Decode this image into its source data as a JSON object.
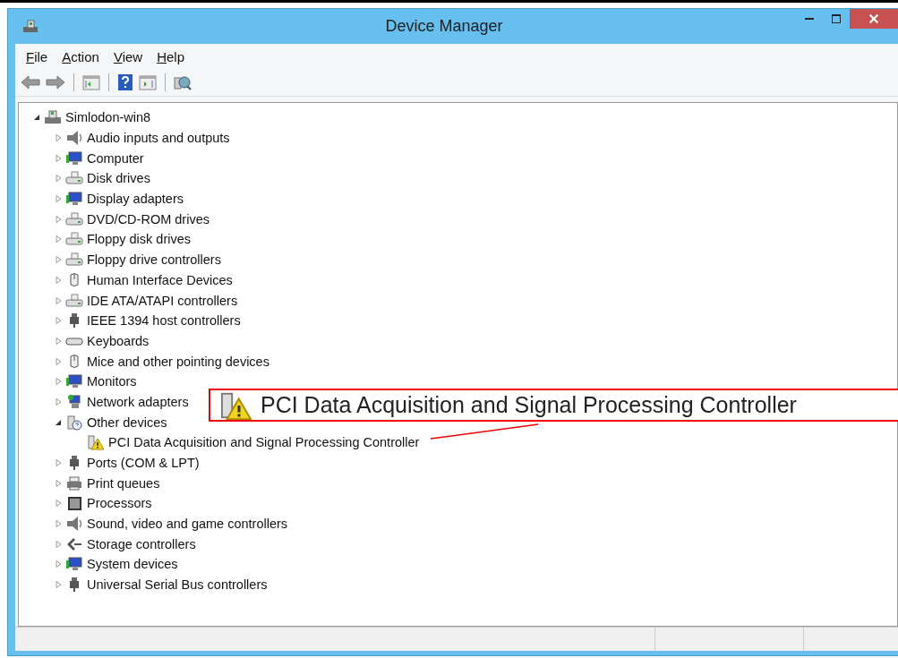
{
  "window": {
    "title": "Device Manager"
  },
  "menu": [
    {
      "label": "File"
    },
    {
      "label": "Action"
    },
    {
      "label": "View"
    },
    {
      "label": "Help"
    }
  ],
  "tree": {
    "label": "Simlodon-win8",
    "kind": "computer",
    "expanded": true,
    "children": [
      {
        "label": "Audio inputs and outputs",
        "kind": "speaker",
        "expanded": false
      },
      {
        "label": "Computer",
        "kind": "monitor",
        "expanded": false
      },
      {
        "label": "Disk drives",
        "kind": "drive",
        "expanded": false
      },
      {
        "label": "Display adapters",
        "kind": "monitor",
        "expanded": false
      },
      {
        "label": "DVD/CD-ROM drives",
        "kind": "drive",
        "expanded": false
      },
      {
        "label": "Floppy disk drives",
        "kind": "drive",
        "expanded": false
      },
      {
        "label": "Floppy drive controllers",
        "kind": "drive",
        "expanded": false
      },
      {
        "label": "Human Interface Devices",
        "kind": "mouse",
        "expanded": false
      },
      {
        "label": "IDE ATA/ATAPI controllers",
        "kind": "drive",
        "expanded": false
      },
      {
        "label": "IEEE 1394 host controllers",
        "kind": "plug",
        "expanded": false
      },
      {
        "label": "Keyboards",
        "kind": "keyboard",
        "expanded": false
      },
      {
        "label": "Mice and other pointing devices",
        "kind": "mouse",
        "expanded": false
      },
      {
        "label": "Monitors",
        "kind": "monitor",
        "expanded": false
      },
      {
        "label": "Network adapters",
        "kind": "network",
        "expanded": false
      },
      {
        "label": "Other devices",
        "kind": "unknown",
        "expanded": true,
        "children": [
          {
            "label": "PCI Data Acquisition and Signal Processing Controller",
            "kind": "warning"
          }
        ]
      },
      {
        "label": "Ports (COM & LPT)",
        "kind": "plug",
        "expanded": false
      },
      {
        "label": "Print queues",
        "kind": "printer",
        "expanded": false
      },
      {
        "label": "Processors",
        "kind": "chip",
        "expanded": false
      },
      {
        "label": "Sound, video and game controllers",
        "kind": "speaker",
        "expanded": false
      },
      {
        "label": "Storage controllers",
        "kind": "storage",
        "expanded": false
      },
      {
        "label": "System devices",
        "kind": "monitor",
        "expanded": false
      },
      {
        "label": "Universal Serial Bus controllers",
        "kind": "plug",
        "expanded": false
      }
    ]
  },
  "callout": {
    "text": "PCI Data Acquisition and Signal Processing Controller"
  }
}
